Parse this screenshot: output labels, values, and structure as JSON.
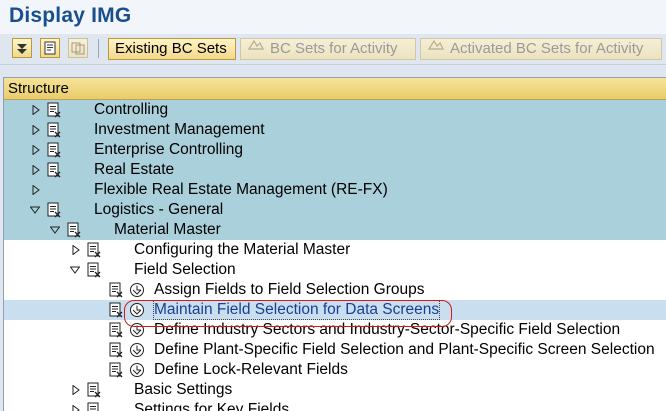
{
  "window": {
    "title": "Display IMG"
  },
  "toolbar": {
    "icons": [
      "expand-subtree-icon",
      "where-used-icon",
      "copy-icon"
    ],
    "existing_bc_sets": "Existing BC Sets",
    "bc_sets_for_activity": "BC Sets for Activity",
    "activated_bc_sets_for_activity": "Activated BC Sets for Activity"
  },
  "structure": {
    "header": "Structure",
    "rows": [
      {
        "label": "Controlling",
        "expanded": false
      },
      {
        "label": "Investment Management",
        "expanded": false
      },
      {
        "label": "Enterprise Controlling",
        "expanded": false
      },
      {
        "label": "Real Estate",
        "expanded": false
      },
      {
        "label": "Flexible Real Estate Management (RE-FX)",
        "expanded": false
      },
      {
        "label": "Logistics - General",
        "expanded": true
      },
      {
        "label": "Material Master",
        "expanded": true
      },
      {
        "label": "Configuring the Material Master",
        "expanded": false
      },
      {
        "label": "Field Selection",
        "expanded": true
      },
      {
        "label": "Assign Fields to Field Selection Groups"
      },
      {
        "label": "Maintain Field Selection for Data Screens",
        "selected": true
      },
      {
        "label": "Define Industry Sectors and Industry-Sector-Specific Field Selection"
      },
      {
        "label": "Define Plant-Specific Field Selection and Plant-Specific Screen Selection"
      },
      {
        "label": "Define Lock-Relevant Fields"
      },
      {
        "label": "Basic Settings",
        "expanded": false
      },
      {
        "label": "Settings for Key Fields",
        "expanded": false
      }
    ]
  },
  "colors": {
    "title": "#1a4f8f",
    "highlight": "#a9d0db",
    "annotation": "#d01818"
  }
}
